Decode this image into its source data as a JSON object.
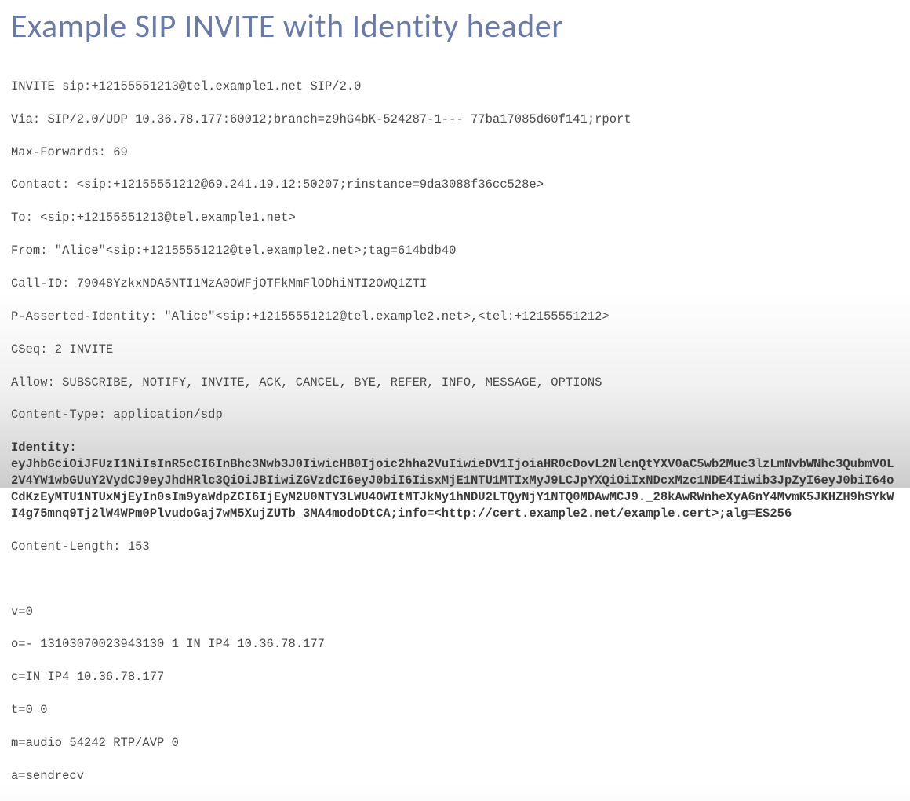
{
  "title": "Example SIP INVITE with Identity header",
  "sip": {
    "request_line": "INVITE sip:+12155551213@tel.example1.net SIP/2.0",
    "via": "Via: SIP/2.0/UDP 10.36.78.177:60012;branch=z9hG4bK-524287-1--- 77ba17085d60f141;rport",
    "max_forwards": "Max-Forwards: 69",
    "contact": "Contact: <sip:+12155551212@69.241.19.12:50207;rinstance=9da3088f36cc528e>",
    "to": "To: <sip:+12155551213@tel.example1.net>",
    "from": "From: \"Alice\"<sip:+12155551212@tel.example2.net>;tag=614bdb40",
    "call_id": "Call-ID: 79048YzkxNDA5NTI1MzA0OWFjOTFkMmFlODhiNTI2OWQ1ZTI",
    "p_asserted_identity": "P-Asserted-Identity: \"Alice\"<sip:+12155551212@tel.example2.net>,<tel:+12155551212>",
    "cseq": "CSeq: 2 INVITE",
    "allow": "Allow: SUBSCRIBE, NOTIFY, INVITE, ACK, CANCEL, BYE, REFER, INFO, MESSAGE, OPTIONS",
    "content_type": "Content-Type: application/sdp",
    "identity": "Identity: eyJhbGciOiJFUzI1NiIsInR5cCI6InBhc3Nwb3J0IiwicHB0Ijoic2hha2VuIiwieDV1IjoiaHR0cDovL2NlcnQtYXV0aC5wb2Muc3lzLmNvbWNhc3QubmV0L2V4YW1wbGUuY2VydCJ9eyJhdHRlc3QiOiJBIiwiZGVzdCI6eyJ0biI6IisxMjE1NTU1MTIxMyJ9LCJpYXQiOiIxNDcxMzc1NDE4Iiwib3JpZyI6eyJ0biI64oCdKzEyMTU1NTUxMjEyIn0sIm9yaWdpZCI6IjEyM2U0NTY3LWU4OWItMTJkMy1hNDU2LTQyNjY1NTQ0MDAwMCJ9._28kAwRWnheXyA6nY4MvmK5JKHZH9hSYkWI4g75mnq9Tj2lW4WPm0PlvudoGaj7wM5XujZUTb_3MA4modoDtCA;info=<http://cert.example2.net/example.cert>;alg=ES256",
    "content_length": "Content-Length: 153",
    "sdp": {
      "v": "v=0",
      "o": "o=- 13103070023943130 1 IN IP4 10.36.78.177",
      "c": "c=IN IP4 10.36.78.177",
      "t": "t=0 0",
      "m": "m=audio 54242 RTP/AVP 0",
      "a": "a=sendrecv"
    }
  }
}
